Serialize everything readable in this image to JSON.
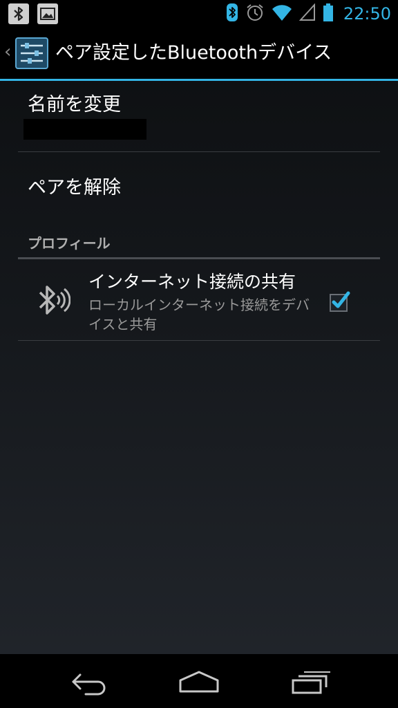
{
  "status_bar": {
    "time": "22:50",
    "notifications": [
      "bluetooth-notification-icon",
      "image-notification-icon"
    ],
    "icons": [
      "bluetooth-icon",
      "alarm-icon",
      "wifi-icon",
      "signal-icon",
      "battery-icon"
    ],
    "accent_color": "#33b5e5"
  },
  "action_bar": {
    "title": "ペア設定したBluetoothデバイス",
    "icon": "settings-sliders-icon"
  },
  "prefs": {
    "rename": {
      "title": "名前を変更"
    },
    "unpair": {
      "title": "ペアを解除"
    }
  },
  "profiles": {
    "header": "プロフィール",
    "items": [
      {
        "title": "インターネット接続の共有",
        "summary": "ローカルインターネット接続をデバイスと共有",
        "checked": true,
        "icon": "bluetooth-pan-icon"
      }
    ]
  },
  "nav_bar": {
    "buttons": [
      "back-icon",
      "home-icon",
      "recent-apps-icon"
    ]
  }
}
